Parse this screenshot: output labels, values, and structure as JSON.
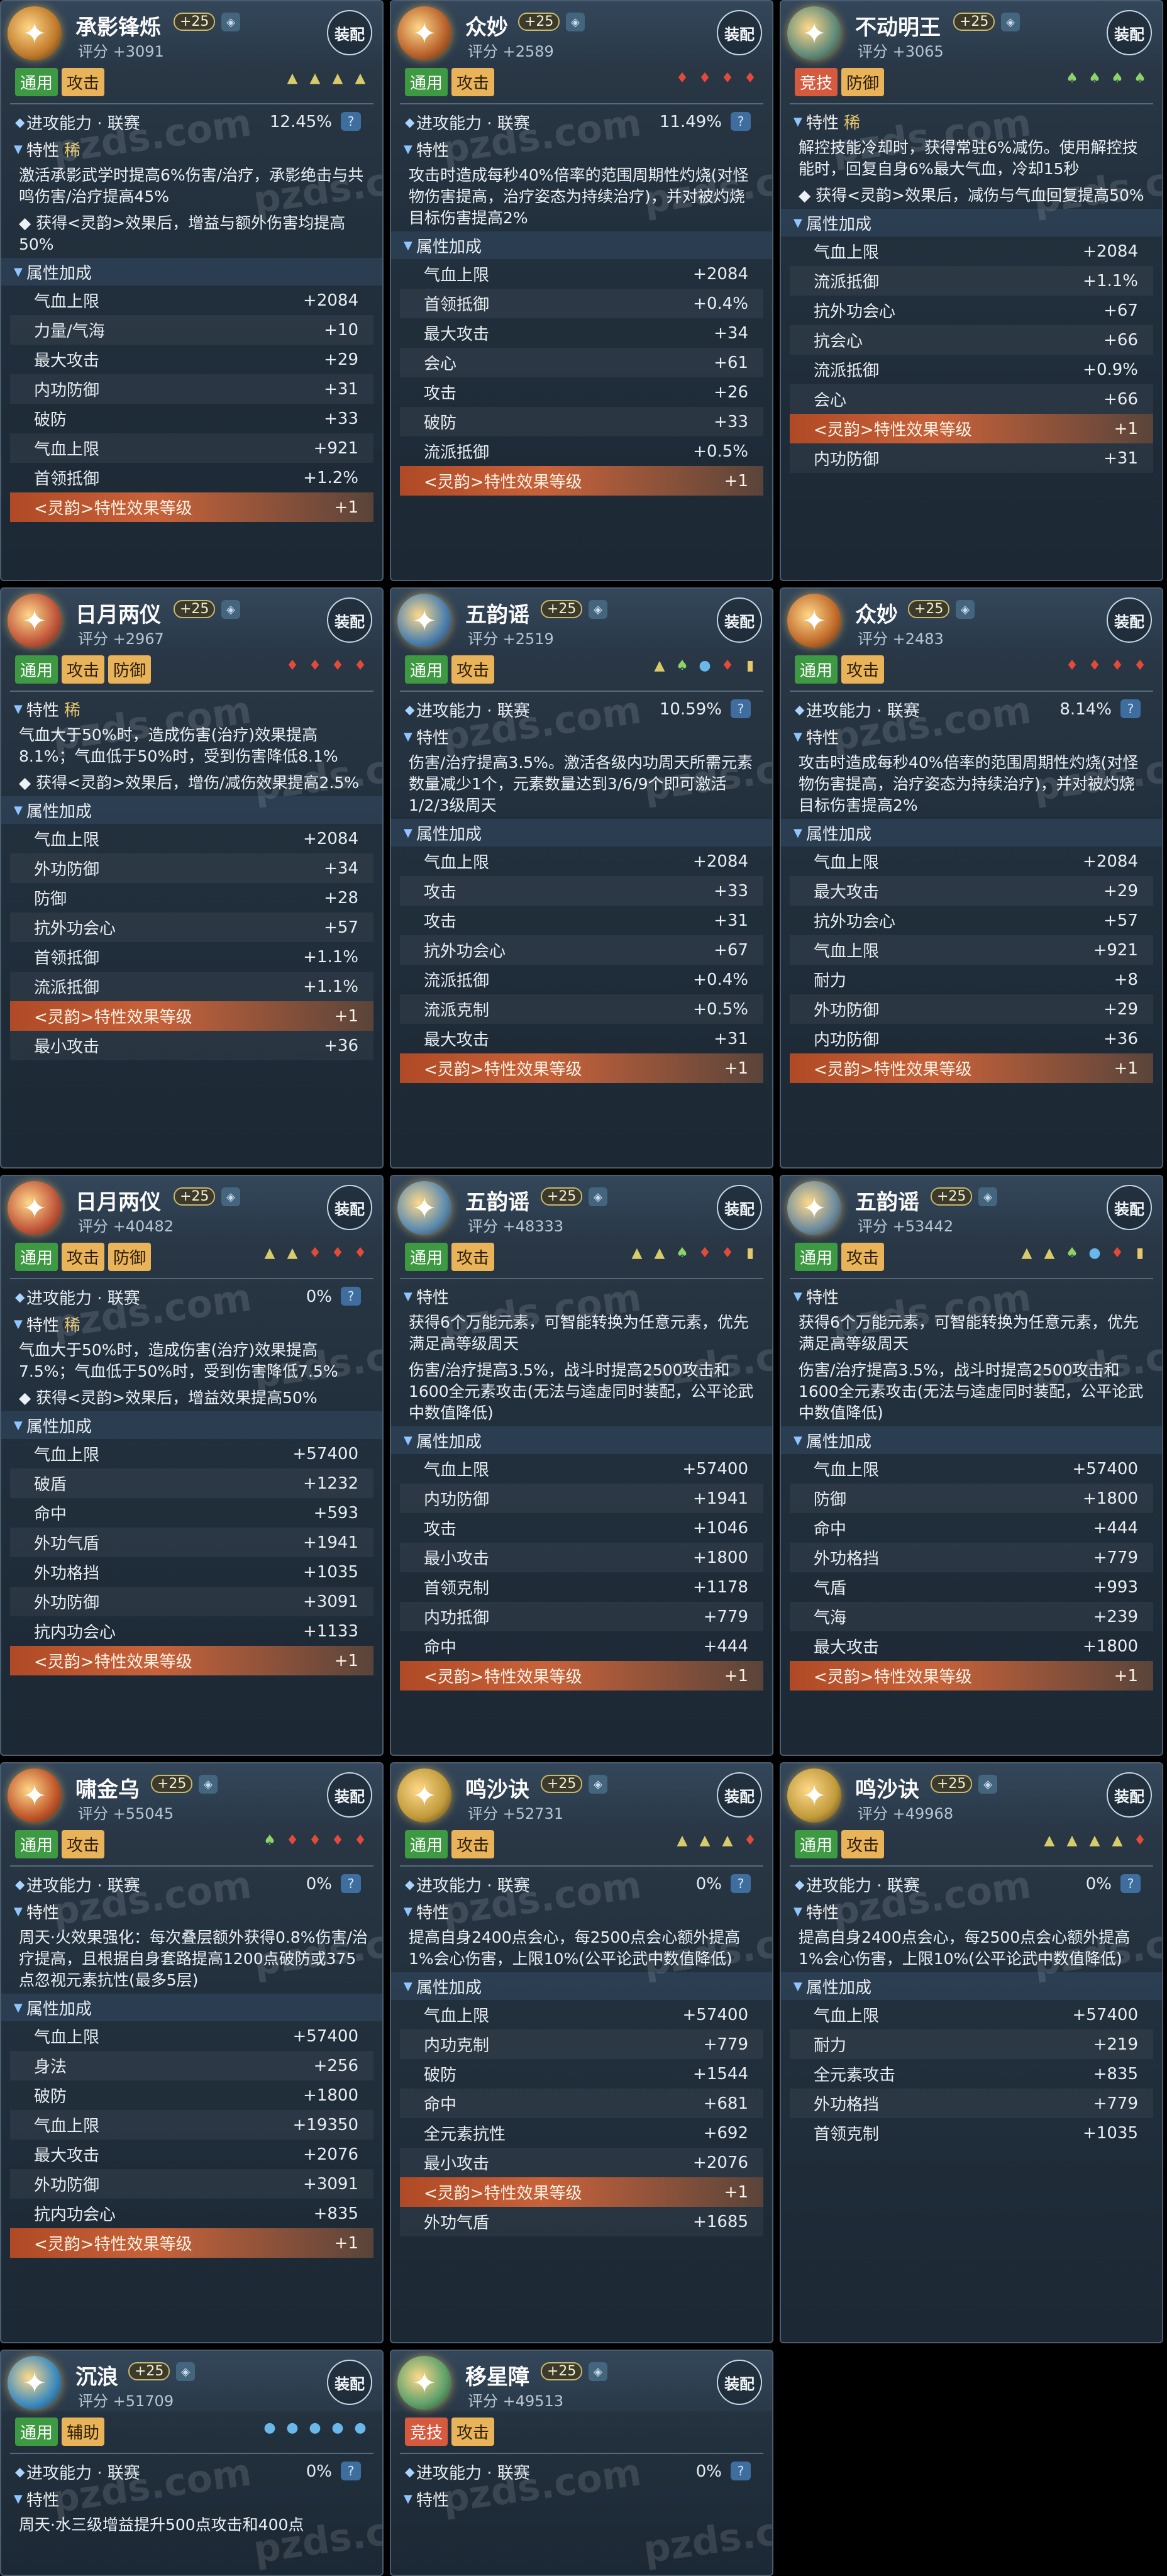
{
  "watermark": "pzds.com",
  "cards": [
    {
      "name": "承影锋烁",
      "level": "+25",
      "score": "评分 +3091",
      "equip": "装配",
      "tags": [
        {
          "label": "通用",
          "color": "green"
        },
        {
          "label": "攻击",
          "color": "yellow"
        }
      ],
      "gems": [
        "tri",
        "tri",
        "tri",
        "tri"
      ],
      "attack_line": "进攻能力 · 联赛",
      "attack_pct": "12.45%",
      "trait_label": "特性",
      "trait_rare": "稀",
      "desc": [
        "激活承影武学时提高6%伤害/治疗，承影绝击与共鸣伤害/治疗提高45%",
        "◆ 获得<灵韵>效果后，增益与额外伤害均提高50%"
      ],
      "attr_label": "属性加成",
      "attrs": [
        {
          "k": "气血上限",
          "v": "+2084"
        },
        {
          "k": "力量/气海",
          "v": "+10"
        },
        {
          "k": "最大攻击",
          "v": "+29"
        },
        {
          "k": "内功防御",
          "v": "+31"
        },
        {
          "k": "破防",
          "v": "+33"
        },
        {
          "k": "气血上限",
          "v": "+921"
        },
        {
          "k": "首领抵御",
          "v": "+1.2%"
        },
        {
          "k": "<灵韵>特性效果等级",
          "v": "+1",
          "special": true
        }
      ]
    },
    {
      "name": "众妙",
      "level": "+25",
      "score": "评分 +2589",
      "equip": "装配",
      "tags": [
        {
          "label": "通用",
          "color": "green"
        },
        {
          "label": "攻击",
          "color": "yellow"
        }
      ],
      "gems": [
        "fire",
        "fire",
        "fire",
        "fire"
      ],
      "attack_line": "进攻能力 · 联赛",
      "attack_pct": "11.49%",
      "trait_label": "特性",
      "trait_rare": "",
      "desc": [
        "攻击时造成每秒40%倍率的范围周期性灼烧(对怪物伤害提高，治疗姿态为持续治疗)，并对被灼烧目标伤害提高2%"
      ],
      "attr_label": "属性加成",
      "attrs": [
        {
          "k": "气血上限",
          "v": "+2084"
        },
        {
          "k": "首领抵御",
          "v": "+0.4%"
        },
        {
          "k": "最大攻击",
          "v": "+34"
        },
        {
          "k": "会心",
          "v": "+61"
        },
        {
          "k": "攻击",
          "v": "+26"
        },
        {
          "k": "破防",
          "v": "+33"
        },
        {
          "k": "流派抵御",
          "v": "+0.5%"
        },
        {
          "k": "<灵韵>特性效果等级",
          "v": "+1",
          "special": true
        }
      ]
    },
    {
      "name": "不动明王",
      "level": "+25",
      "score": "评分 +3065",
      "equip": "装配",
      "tags": [
        {
          "label": "竞技",
          "color": "red"
        },
        {
          "label": "防御",
          "color": "yellow"
        }
      ],
      "gems": [
        "leaf",
        "leaf",
        "leaf",
        "leaf"
      ],
      "attack_line": "",
      "attack_pct": "",
      "trait_label": "特性",
      "trait_rare": "稀",
      "desc": [
        "解控技能冷却时，获得常驻6%减伤。使用解控技能时，回复自身6%最大气血，冷却15秒",
        "◆ 获得<灵韵>效果后，减伤与气血回复提高50%"
      ],
      "attr_label": "属性加成",
      "attrs": [
        {
          "k": "气血上限",
          "v": "+2084"
        },
        {
          "k": "流派抵御",
          "v": "+1.1%"
        },
        {
          "k": "抗外功会心",
          "v": "+67"
        },
        {
          "k": "抗会心",
          "v": "+66"
        },
        {
          "k": "流派抵御",
          "v": "+0.9%"
        },
        {
          "k": "会心",
          "v": "+66"
        },
        {
          "k": "<灵韵>特性效果等级",
          "v": "+1",
          "special": true
        },
        {
          "k": "内功防御",
          "v": "+31"
        }
      ]
    },
    {
      "name": "日月两仪",
      "level": "+25",
      "score": "评分 +2967",
      "equip": "装配",
      "tags": [
        {
          "label": "通用",
          "color": "green"
        },
        {
          "label": "攻击",
          "color": "yellow"
        },
        {
          "label": "防御",
          "color": "yellow"
        }
      ],
      "gems": [
        "fire",
        "fire",
        "fire",
        "fire"
      ],
      "attack_line": "",
      "attack_pct": "",
      "trait_label": "特性",
      "trait_rare": "稀",
      "desc": [
        "气血大于50%时，造成伤害(治疗)效果提高8.1%；气血低于50%时，受到伤害降低8.1%",
        "◆ 获得<灵韵>效果后，增伤/减伤效果提高2.5%"
      ],
      "attr_label": "属性加成",
      "attrs": [
        {
          "k": "气血上限",
          "v": "+2084"
        },
        {
          "k": "外功防御",
          "v": "+34"
        },
        {
          "k": "防御",
          "v": "+28"
        },
        {
          "k": "抗外功会心",
          "v": "+57"
        },
        {
          "k": "首领抵御",
          "v": "+1.1%"
        },
        {
          "k": "流派抵御",
          "v": "+1.1%"
        },
        {
          "k": "<灵韵>特性效果等级",
          "v": "+1",
          "special": true
        },
        {
          "k": "最小攻击",
          "v": "+36"
        }
      ]
    },
    {
      "name": "五韵谣",
      "level": "+25",
      "score": "评分 +2519",
      "equip": "装配",
      "tags": [
        {
          "label": "通用",
          "color": "green"
        },
        {
          "label": "攻击",
          "color": "yellow"
        }
      ],
      "gems": [
        "tri",
        "leaf",
        "water",
        "fire",
        "hat"
      ],
      "attack_line": "进攻能力 · 联赛",
      "attack_pct": "10.59%",
      "trait_label": "特性",
      "trait_rare": "",
      "desc": [
        "伤害/治疗提高3.5%。激活各级内功周天所需元素数量减少1个，元素数量达到3/6/9个即可激活1/2/3级周天"
      ],
      "attr_label": "属性加成",
      "attrs": [
        {
          "k": "气血上限",
          "v": "+2084"
        },
        {
          "k": "攻击",
          "v": "+33"
        },
        {
          "k": "攻击",
          "v": "+31"
        },
        {
          "k": "抗外功会心",
          "v": "+67"
        },
        {
          "k": "流派抵御",
          "v": "+0.4%"
        },
        {
          "k": "流派克制",
          "v": "+0.5%"
        },
        {
          "k": "最大攻击",
          "v": "+31"
        },
        {
          "k": "<灵韵>特性效果等级",
          "v": "+1",
          "special": true
        }
      ]
    },
    {
      "name": "众妙",
      "level": "+25",
      "score": "评分 +2483",
      "equip": "装配",
      "tags": [
        {
          "label": "通用",
          "color": "green"
        },
        {
          "label": "攻击",
          "color": "yellow"
        }
      ],
      "gems": [
        "fire",
        "fire",
        "fire",
        "fire"
      ],
      "attack_line": "进攻能力 · 联赛",
      "attack_pct": "8.14%",
      "trait_label": "特性",
      "trait_rare": "",
      "desc": [
        "攻击时造成每秒40%倍率的范围周期性灼烧(对怪物伤害提高，治疗姿态为持续治疗)，并对被灼烧目标伤害提高2%"
      ],
      "attr_label": "属性加成",
      "attrs": [
        {
          "k": "气血上限",
          "v": "+2084"
        },
        {
          "k": "最大攻击",
          "v": "+29"
        },
        {
          "k": "抗外功会心",
          "v": "+57"
        },
        {
          "k": "气血上限",
          "v": "+921"
        },
        {
          "k": "耐力",
          "v": "+8"
        },
        {
          "k": "外功防御",
          "v": "+29"
        },
        {
          "k": "内功防御",
          "v": "+36"
        },
        {
          "k": "<灵韵>特性效果等级",
          "v": "+1",
          "special": true
        }
      ]
    },
    {
      "name": "日月两仪",
      "level": "+25",
      "score": "评分 +40482",
      "equip": "装配",
      "tags": [
        {
          "label": "通用",
          "color": "green"
        },
        {
          "label": "攻击",
          "color": "yellow"
        },
        {
          "label": "防御",
          "color": "yellow"
        }
      ],
      "gems": [
        "tri",
        "tri",
        "fire",
        "fire",
        "fire"
      ],
      "attack_line": "进攻能力 · 联赛",
      "attack_pct": "0%",
      "trait_label": "特性",
      "trait_rare": "稀",
      "desc": [
        "气血大于50%时，造成伤害(治疗)效果提高7.5%；气血低于50%时，受到伤害降低7.5%",
        "◆ 获得<灵韵>效果后，增益效果提高50%"
      ],
      "attr_label": "属性加成",
      "attrs": [
        {
          "k": "气血上限",
          "v": "+57400"
        },
        {
          "k": "破盾",
          "v": "+1232"
        },
        {
          "k": "命中",
          "v": "+593"
        },
        {
          "k": "外功气盾",
          "v": "+1941"
        },
        {
          "k": "外功格挡",
          "v": "+1035"
        },
        {
          "k": "外功防御",
          "v": "+3091"
        },
        {
          "k": "抗内功会心",
          "v": "+1133"
        },
        {
          "k": "<灵韵>特性效果等级",
          "v": "+1",
          "special": true
        }
      ]
    },
    {
      "name": "五韵谣",
      "level": "+25",
      "score": "评分 +48333",
      "equip": "装配",
      "tags": [
        {
          "label": "通用",
          "color": "green"
        },
        {
          "label": "攻击",
          "color": "yellow"
        }
      ],
      "gems": [
        "tri",
        "tri",
        "leaf",
        "fire",
        "fire",
        "hat"
      ],
      "attack_line": "",
      "attack_pct": "",
      "trait_label": "特性",
      "trait_rare": "",
      "desc": [
        "获得6个万能元素，可智能转换为任意元素，优先满足高等级周天",
        "伤害/治疗提高3.5%，战斗时提高2500攻击和1600全元素攻击(无法与逵虚同时装配，公平论武中数值降低)"
      ],
      "attr_label": "属性加成",
      "attrs": [
        {
          "k": "气血上限",
          "v": "+57400"
        },
        {
          "k": "内功防御",
          "v": "+1941"
        },
        {
          "k": "攻击",
          "v": "+1046"
        },
        {
          "k": "最小攻击",
          "v": "+1800"
        },
        {
          "k": "首领克制",
          "v": "+1178"
        },
        {
          "k": "内功抵御",
          "v": "+779"
        },
        {
          "k": "命中",
          "v": "+444"
        },
        {
          "k": "<灵韵>特性效果等级",
          "v": "+1",
          "special": true
        }
      ]
    },
    {
      "name": "五韵谣",
      "level": "+25",
      "score": "评分 +53442",
      "equip": "装配",
      "tags": [
        {
          "label": "通用",
          "color": "green"
        },
        {
          "label": "攻击",
          "color": "yellow"
        }
      ],
      "gems": [
        "tri",
        "tri",
        "leaf",
        "water",
        "fire",
        "hat"
      ],
      "attack_line": "",
      "attack_pct": "",
      "trait_label": "特性",
      "trait_rare": "",
      "desc": [
        "获得6个万能元素，可智能转换为任意元素，优先满足高等级周天",
        "伤害/治疗提高3.5%，战斗时提高2500攻击和1600全元素攻击(无法与逵虚同时装配，公平论武中数值降低)"
      ],
      "attr_label": "属性加成",
      "attrs": [
        {
          "k": "气血上限",
          "v": "+57400"
        },
        {
          "k": "防御",
          "v": "+1800"
        },
        {
          "k": "命中",
          "v": "+444"
        },
        {
          "k": "外功格挡",
          "v": "+779"
        },
        {
          "k": "气盾",
          "v": "+993"
        },
        {
          "k": "气海",
          "v": "+239"
        },
        {
          "k": "最大攻击",
          "v": "+1800"
        },
        {
          "k": "<灵韵>特性效果等级",
          "v": "+1",
          "special": true
        }
      ]
    },
    {
      "name": "啸金乌",
      "level": "+25",
      "score": "评分 +55045",
      "equip": "装配",
      "tags": [
        {
          "label": "通用",
          "color": "green"
        },
        {
          "label": "攻击",
          "color": "yellow"
        }
      ],
      "gems": [
        "leaf",
        "fire",
        "fire",
        "fire",
        "fire"
      ],
      "attack_line": "进攻能力 · 联赛",
      "attack_pct": "0%",
      "trait_label": "特性",
      "trait_rare": "",
      "desc": [
        "周天·火效果强化：每次叠层额外获得0.8%伤害/治疗提高，且根据自身套路提高1200点破防或375点忽视元素抗性(最多5层)"
      ],
      "attr_label": "属性加成",
      "attrs": [
        {
          "k": "气血上限",
          "v": "+57400"
        },
        {
          "k": "身法",
          "v": "+256"
        },
        {
          "k": "破防",
          "v": "+1800"
        },
        {
          "k": "气血上限",
          "v": "+19350"
        },
        {
          "k": "最大攻击",
          "v": "+2076"
        },
        {
          "k": "外功防御",
          "v": "+3091"
        },
        {
          "k": "抗内功会心",
          "v": "+835"
        },
        {
          "k": "<灵韵>特性效果等级",
          "v": "+1",
          "special": true
        }
      ]
    },
    {
      "name": "鸣沙诀",
      "level": "+25",
      "score": "评分 +52731",
      "equip": "装配",
      "tags": [
        {
          "label": "通用",
          "color": "green"
        },
        {
          "label": "攻击",
          "color": "yellow"
        }
      ],
      "gems": [
        "tri",
        "tri",
        "tri",
        "fire"
      ],
      "attack_line": "进攻能力 · 联赛",
      "attack_pct": "0%",
      "trait_label": "特性",
      "trait_rare": "",
      "desc": [
        "提高自身2400点会心，每2500点会心额外提高1%会心伤害，上限10%(公平论武中数值降低)"
      ],
      "attr_label": "属性加成",
      "attrs": [
        {
          "k": "气血上限",
          "v": "+57400"
        },
        {
          "k": "内功克制",
          "v": "+779"
        },
        {
          "k": "破防",
          "v": "+1544"
        },
        {
          "k": "命中",
          "v": "+681"
        },
        {
          "k": "全元素抗性",
          "v": "+692"
        },
        {
          "k": "最小攻击",
          "v": "+2076"
        },
        {
          "k": "<灵韵>特性效果等级",
          "v": "+1",
          "special": true
        },
        {
          "k": "外功气盾",
          "v": "+1685"
        }
      ]
    },
    {
      "name": "鸣沙诀",
      "level": "+25",
      "score": "评分 +49968",
      "equip": "装配",
      "tags": [
        {
          "label": "通用",
          "color": "green"
        },
        {
          "label": "攻击",
          "color": "yellow"
        }
      ],
      "gems": [
        "tri",
        "tri",
        "tri",
        "tri",
        "fire"
      ],
      "attack_line": "进攻能力 · 联赛",
      "attack_pct": "0%",
      "trait_label": "特性",
      "trait_rare": "",
      "desc": [
        "提高自身2400点会心，每2500点会心额外提高1%会心伤害，上限10%(公平论武中数值降低)"
      ],
      "attr_label": "属性加成",
      "attrs": [
        {
          "k": "气血上限",
          "v": "+57400"
        },
        {
          "k": "耐力",
          "v": "+219"
        },
        {
          "k": "全元素攻击",
          "v": "+835"
        },
        {
          "k": "外功格挡",
          "v": "+779"
        },
        {
          "k": "首领克制",
          "v": "+1035"
        }
      ]
    },
    {
      "name": "沉浪",
      "level": "+25",
      "score": "评分 +51709",
      "equip": "装配",
      "tags": [
        {
          "label": "通用",
          "color": "green"
        },
        {
          "label": "辅助",
          "color": "yellow"
        }
      ],
      "gems": [
        "water",
        "water",
        "water",
        "water",
        "water"
      ],
      "attack_line": "进攻能力 · 联赛",
      "attack_pct": "0%",
      "trait_label": "特性",
      "trait_rare": "",
      "desc": [
        "周天·水三级增益提升500点攻击和400点"
      ],
      "attr_label": "",
      "attrs": []
    },
    {
      "name": "移星障",
      "level": "+25",
      "score": "评分 +49513",
      "equip": "装配",
      "tags": [
        {
          "label": "竞技",
          "color": "red"
        },
        {
          "label": "攻击",
          "color": "yellow"
        }
      ],
      "gems": [],
      "attack_line": "进攻能力 · 联赛",
      "attack_pct": "0%",
      "trait_label": "特性",
      "trait_rare": "",
      "desc": [],
      "attr_label": "",
      "attrs": []
    }
  ]
}
